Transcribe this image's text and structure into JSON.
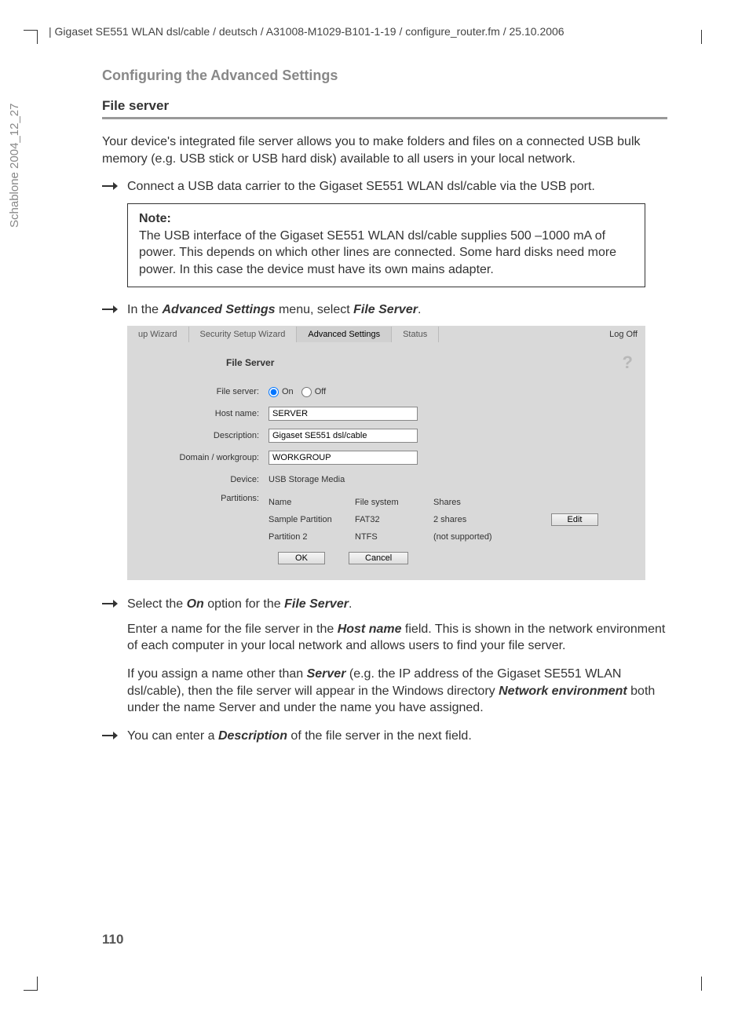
{
  "header": "| Gigaset SE551 WLAN dsl/cable / deutsch / A31008-M1029-B101-1-19 / configure_router.fm / 25.10.2006",
  "side_text": "Schablone 2004_12_27",
  "section_title": "Configuring the Advanced Settings",
  "subsection": "File server",
  "intro": "Your device's integrated file server allows you to make folders and files on a connected USB bulk memory (e.g. USB stick or USB hard disk) available to all users in your local network.",
  "step1": "Connect a USB data carrier to the Gigaset SE551 WLAN dsl/cable via the USB port.",
  "note": {
    "title": "Note:",
    "body": "The USB interface of the Gigaset SE551 WLAN dsl/cable supplies 500 –1000 mA of power. This depends on which other lines are connected. Some hard disks need more power. In this case the device must have its own mains adapter."
  },
  "step2": {
    "pre": "In the ",
    "b1": "Advanced Settings",
    "mid": " menu, select ",
    "b2": "File Server",
    "post": "."
  },
  "screenshot": {
    "tabs": [
      "up Wizard",
      "Security Setup Wizard",
      "Advanced Settings",
      "Status"
    ],
    "logoff": "Log Off",
    "help": "?",
    "title": "File Server",
    "rows": {
      "file_server_lbl": "File server:",
      "on_lbl": "On",
      "off_lbl": "Off",
      "host_lbl": "Host name:",
      "host_val": "SERVER",
      "desc_lbl": "Description:",
      "desc_val": "Gigaset SE551 dsl/cable",
      "domain_lbl": "Domain / workgroup:",
      "domain_val": "WORKGROUP",
      "device_lbl": "Device:",
      "device_val": "USB Storage Media",
      "part_lbl": "Partitions:"
    },
    "table": {
      "h_name": "Name",
      "h_fs": "File system",
      "h_shares": "Shares",
      "rows": [
        {
          "name": "Sample Partition",
          "fs": "FAT32",
          "shares": "2 shares",
          "edit": "Edit"
        },
        {
          "name": "Partition 2",
          "fs": "NTFS",
          "shares": "(not supported)",
          "edit": ""
        }
      ]
    },
    "ok": "OK",
    "cancel": "Cancel"
  },
  "step3": {
    "pre": "Select the ",
    "b1": "On",
    "mid": " option for the ",
    "b2": "File Server",
    "post": "."
  },
  "para1": {
    "pre": "Enter a name for the file server in the ",
    "b1": "Host name",
    "post": " field. This is shown in the network environment of each computer in your local network and allows users to find your file server."
  },
  "para2": {
    "pre": "If you assign a name other than ",
    "b1": "Server",
    "mid": " (e.g. the IP address of the Gigaset SE551 WLAN dsl/cable), then the file server will appear in the Windows directory ",
    "b2": "Network environment",
    "post": " both under the name Server and under the name you have assigned."
  },
  "step4": {
    "pre": "You can enter a ",
    "b1": "Description",
    "post": " of the file server in the next field."
  },
  "page_num": "110"
}
